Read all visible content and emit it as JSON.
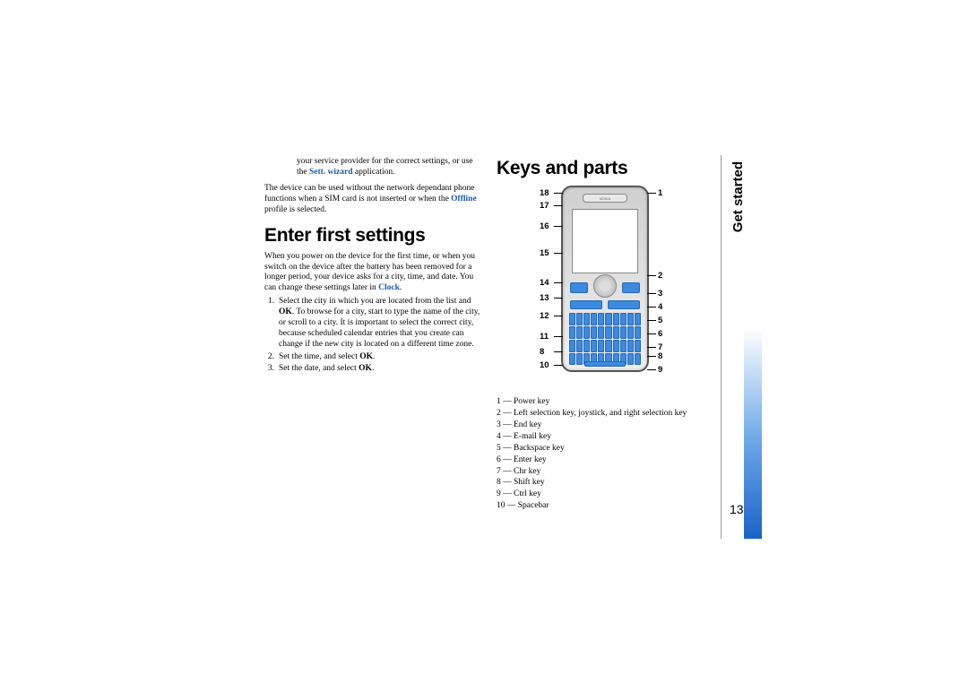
{
  "margin": {
    "section_title": "Get started",
    "page_number": "13"
  },
  "col1": {
    "intro_para": "your service provider for the correct settings, or use the ",
    "intro_link": "Sett. wizard",
    "intro_tail": " application.",
    "para2_a": "The device can be used without the network dependant phone functions when a SIM card is not inserted or when the ",
    "para2_link": "Offline",
    "para2_b": " profile is selected.",
    "heading": "Enter first settings",
    "para3_a": "When you power on the device for the first time, or when you switch on the device after the battery has been removed for a longer period, your device asks for a city, time, and date. You can change these settings later in ",
    "para3_link": "Clock",
    "para3_b": ".",
    "steps": [
      {
        "n": "1.",
        "a": "Select the city in which you are located from the list and ",
        "ok": "OK",
        ". ": "",
        "b": ". To browse for a city, start to type the name of the city, or scroll to a city. It is important to select the correct city, because scheduled calendar entries that you create can change if the new city is located on a different time zone."
      },
      {
        "n": "2.",
        "a": "Set the time, and select ",
        "ok": "OK",
        "b": "."
      },
      {
        "n": "3.",
        "a": "Set the date, and select ",
        "ok": "OK",
        "b": "."
      }
    ]
  },
  "col2": {
    "heading": "Keys and parts",
    "earpiece_brand": "NOKIA",
    "labels_left": [
      [
        18,
        "18"
      ],
      [
        17,
        "17"
      ],
      [
        16,
        "16"
      ],
      [
        15,
        "15"
      ],
      [
        14,
        "14"
      ],
      [
        13,
        "13"
      ],
      [
        12,
        "12"
      ],
      [
        11,
        "11"
      ],
      [
        8,
        "8"
      ],
      [
        10,
        "10"
      ]
    ],
    "labels_right": [
      [
        1,
        "1"
      ],
      [
        2,
        "2"
      ],
      [
        3,
        "3"
      ],
      [
        4,
        "4"
      ],
      [
        5,
        "5"
      ],
      [
        6,
        "6"
      ],
      [
        7,
        "7"
      ],
      [
        8,
        "8"
      ],
      [
        9,
        "9"
      ]
    ],
    "legend": [
      "1 — Power key",
      "2 — Left selection key, joystick, and right selection key",
      "3 — End key",
      "4 — E-mail key",
      "5 — Backspace key",
      "6 — Enter key",
      "7 — Chr key",
      "8 — Shift key",
      "9 — Ctrl key",
      "10 — Spacebar"
    ]
  },
  "chart_data": {
    "type": "diagram",
    "title": "Keys and parts",
    "callouts_left": [
      18,
      17,
      16,
      15,
      14,
      13,
      12,
      11,
      8,
      10
    ],
    "callouts_right": [
      1,
      2,
      3,
      4,
      5,
      6,
      7,
      8,
      9
    ],
    "legend": {
      "1": "Power key",
      "2": "Left selection key, joystick, and right selection key",
      "3": "End key",
      "4": "E-mail key",
      "5": "Backspace key",
      "6": "Enter key",
      "7": "Chr key",
      "8": "Shift key",
      "9": "Ctrl key",
      "10": "Spacebar"
    }
  }
}
